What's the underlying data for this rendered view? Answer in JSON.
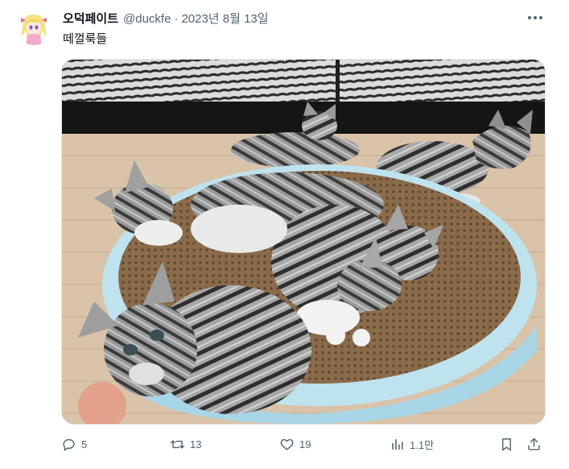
{
  "tweet": {
    "author": {
      "display_name": "오덕페이트",
      "handle": "@duckfe",
      "avatar_icon": "anime-avatar"
    },
    "separator": "·",
    "date": "2023년 8월 13일",
    "text": "떼껄룩들",
    "media": {
      "kind": "photo",
      "description_icon": "kittens-photo"
    },
    "more_icon": "more-dots-icon",
    "actions": {
      "reply": {
        "icon": "reply-icon",
        "count": "5"
      },
      "retweet": {
        "icon": "retweet-icon",
        "count": "13"
      },
      "like": {
        "icon": "heart-icon",
        "count": "19"
      },
      "views": {
        "icon": "views-icon",
        "count": "1.1만"
      },
      "bookmark": {
        "icon": "bookmark-icon"
      },
      "share": {
        "icon": "share-icon"
      }
    }
  },
  "colors": {
    "text_primary": "#0f1419",
    "text_secondary": "#536471",
    "background": "#ffffff"
  }
}
